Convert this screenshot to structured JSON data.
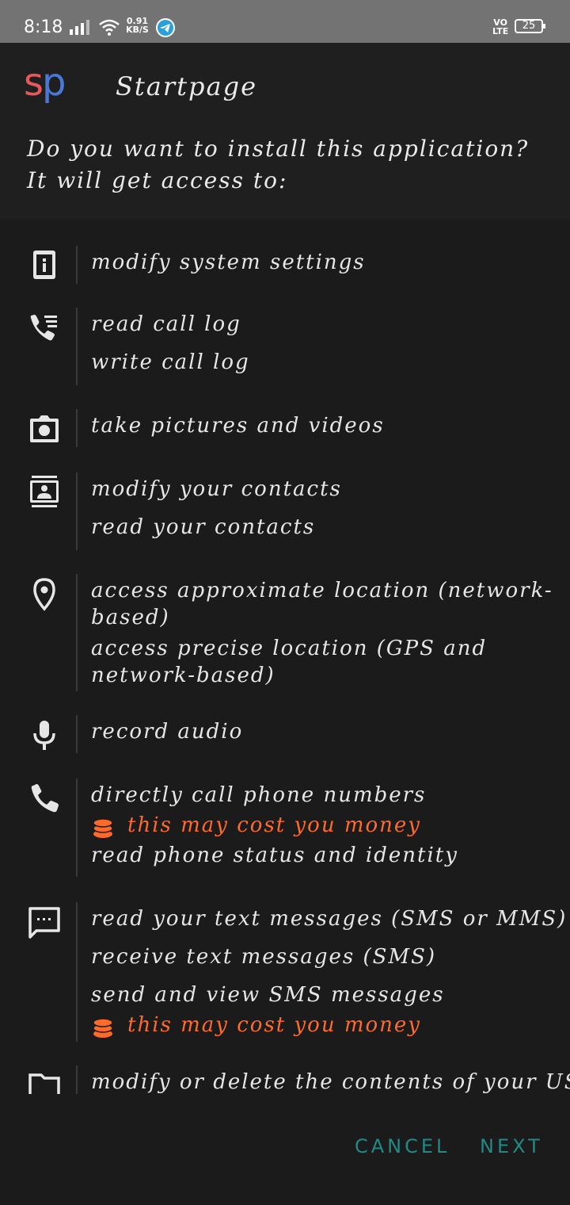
{
  "status_bar": {
    "time": "8:18",
    "speed_value": "0.91",
    "speed_unit": "KB/S",
    "volte_top": "VO",
    "volte_bottom": "LTE",
    "battery": "25"
  },
  "app": {
    "logo_s": "s",
    "logo_p": "p",
    "name": "Startpage",
    "question": "Do you want to install this application? It will get access to:"
  },
  "permissions": {
    "system_settings": "modify system settings",
    "read_call_log": "read call log",
    "write_call_log": "write call log",
    "camera": "take pictures and videos",
    "modify_contacts": "modify your contacts",
    "read_contacts": "read your contacts",
    "approx_location": "access approximate location (network-based)",
    "precise_location": "access precise location (GPS and network-based)",
    "record_audio": "record audio",
    "call_phone": "directly call phone numbers",
    "cost_warning_1": "this may cost you money",
    "phone_status": "read phone status and identity",
    "read_sms": "read your text messages (SMS or MMS)",
    "receive_sms": "receive text messages (SMS)",
    "send_sms": "send and view SMS messages",
    "cost_warning_2": "this may cost you money",
    "storage": "modify or delete the contents of your USB"
  },
  "buttons": {
    "cancel": "CANCEL",
    "next": "NEXT"
  },
  "colors": {
    "background": "#1b1b1b",
    "status_bar": "#737373",
    "cost_warning": "#ff6a2a",
    "button_text": "#1f8a86",
    "logo_s": "#e8585a",
    "logo_p": "#4a78d8"
  }
}
